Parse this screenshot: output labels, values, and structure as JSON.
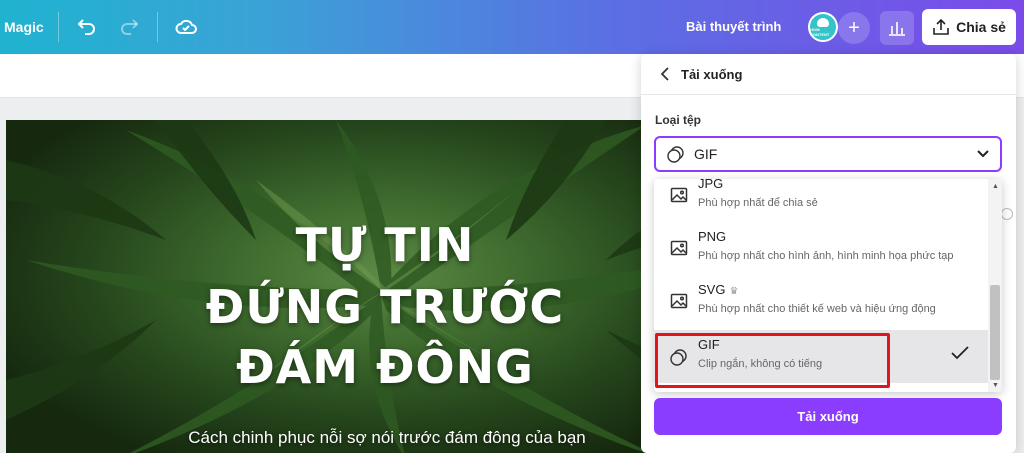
{
  "toolbar": {
    "brand": "Magic",
    "doc_title": "Bài thuyết trình",
    "avatar_text": "HOW CONTENT",
    "share_label": "Chia sẻ",
    "icons": [
      "undo-icon",
      "redo-icon",
      "cloud-saved-icon",
      "plus-icon",
      "bar-chart-icon",
      "upload-icon"
    ]
  },
  "slide": {
    "title_lines": [
      "TỰ TIN",
      "ĐỨNG TRƯỚC",
      "ĐÁM ĐÔNG"
    ],
    "subtitle": "Cách chinh phục nỗi sợ nói trước đám đông của bạn"
  },
  "panel": {
    "title": "Tải xuống",
    "file_type_label": "Loại tệp",
    "selected_value": "GIF",
    "options": [
      {
        "name": "JPG",
        "desc": "Phù hợp nhất để chia sẻ",
        "icon": "image-icon"
      },
      {
        "name": "PNG",
        "desc": "Phù hợp nhất cho hình ảnh, hình minh họa phức tạp",
        "icon": "image-icon"
      },
      {
        "name": "SVG",
        "desc": "Phù hợp nhất cho thiết kế web và hiệu ứng động",
        "icon": "image-icon",
        "badge": "♛"
      },
      {
        "name": "GIF",
        "desc": "Clip ngắn, không có tiếng",
        "icon": "gif-icon",
        "selected": true
      }
    ],
    "download_label": "Tải xuống"
  },
  "colors": {
    "accent": "#8b3dff",
    "highlight": "#e3141b",
    "topbar_start": "#1fb3cf",
    "topbar_end": "#7b4bea"
  }
}
